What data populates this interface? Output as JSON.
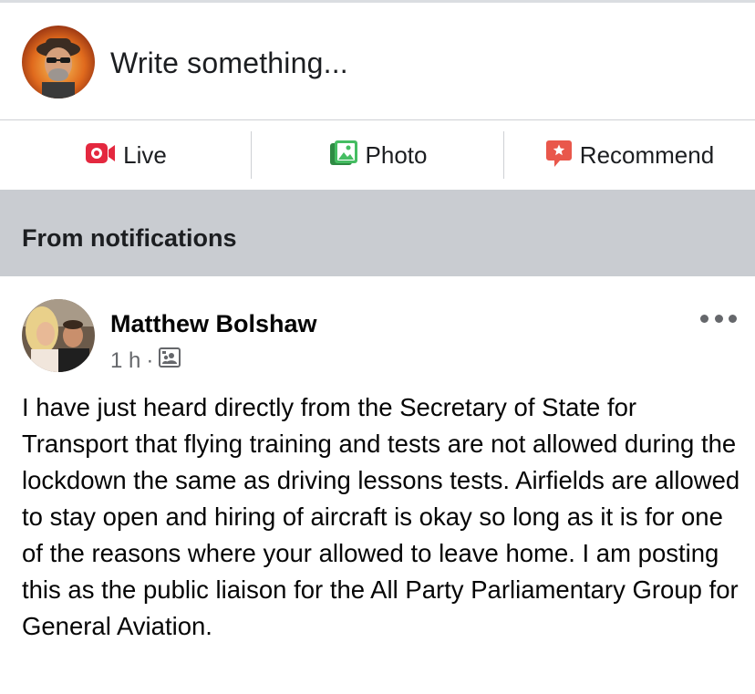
{
  "composer": {
    "prompt": "Write something..."
  },
  "actions": {
    "live": {
      "label": "Live",
      "icon": "live-video-icon",
      "color": "#e4283f"
    },
    "photo": {
      "label": "Photo",
      "icon": "photo-icon",
      "color": "#45bd62"
    },
    "recommend": {
      "label": "Recommend",
      "icon": "recommend-icon",
      "color": "#e9574b"
    }
  },
  "section": {
    "title": "From notifications"
  },
  "post": {
    "author": "Matthew Bolshaw",
    "time": "1 h",
    "separator": "·",
    "audience_icon": "group-audience-icon",
    "body": "I have just heard directly from the Secretary of State for Transport that flying training and tests are not allowed during the lockdown the same as driving lessons tests. Airfields are allowed to stay open and hiring of aircraft is okay so long as it is for one of the reasons where your allowed to leave home. I am posting this as the public liaison for the All Party Parliamentary Group for General Aviation."
  }
}
